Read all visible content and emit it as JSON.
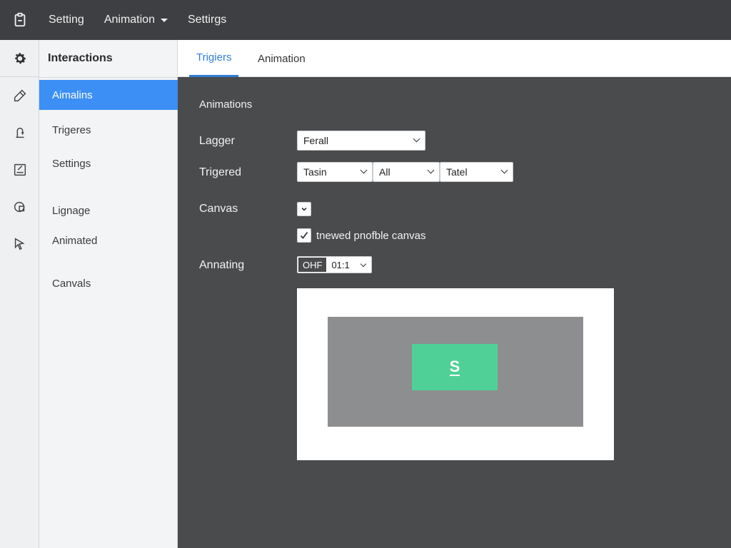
{
  "menubar": {
    "app_icon": "clipboard-icon",
    "items": [
      {
        "label": "Setting"
      },
      {
        "label": "Animation",
        "has_dropdown": true
      },
      {
        "label": "Settirgs"
      }
    ]
  },
  "rail": {
    "icons": [
      "gear-icon",
      "pencil-icon",
      "bell-icon",
      "edit-list-icon",
      "shapes-icon",
      "cursor-icon"
    ]
  },
  "sidebar": {
    "title": "Interactions",
    "items": [
      {
        "label": "Aimalins",
        "active": true
      },
      {
        "label": "Trigeres"
      },
      {
        "label": "Settings"
      },
      {
        "label": "Lignage"
      },
      {
        "label": "Animated"
      },
      {
        "label": "Canvals"
      }
    ]
  },
  "tabs": [
    {
      "label": "Trigiers",
      "active": true
    },
    {
      "label": "Animation"
    }
  ],
  "panel": {
    "title": "Animations",
    "lagger": {
      "label": "Lagger",
      "value": "Ferall"
    },
    "trigered": {
      "label": "Trigered",
      "values": [
        "Tasin",
        "All",
        "Tatel"
      ]
    },
    "canvas": {
      "label": "Canvas",
      "option_label": "tnewed pnofble canvas",
      "option_checked": true
    },
    "annating": {
      "label": "Annating",
      "toggle": "OHF",
      "value": "01:1"
    },
    "preview": {
      "object_label": "S"
    }
  },
  "colors": {
    "topbar": "#3e3f42",
    "panel_bg": "#4a4b4d",
    "accent": "#3b8ff5",
    "tab_accent": "#2f7ed8",
    "canvas_object": "#4fd097",
    "canvas_inner": "#8d8e8f"
  }
}
